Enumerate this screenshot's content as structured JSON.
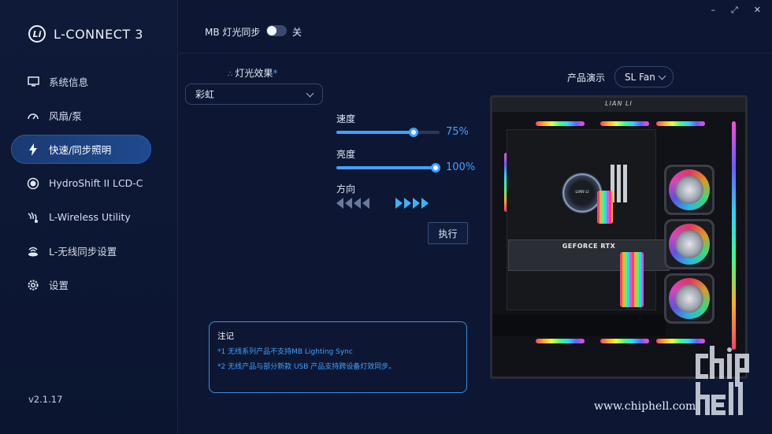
{
  "app": {
    "logo_glyph": "Li",
    "title": "L-CONNECT 3",
    "version": "v2.1.17"
  },
  "sidebar": {
    "items": [
      {
        "label": "系统信息",
        "icon": "monitor-icon"
      },
      {
        "label": "风扇/泵",
        "icon": "gauge-icon"
      },
      {
        "label": "快速/同步照明",
        "icon": "lightning-icon",
        "active": true
      },
      {
        "label": "HydroShift II LCD-C",
        "icon": "circle-icon"
      },
      {
        "label": "L-Wireless Utility",
        "icon": "wireless-fan-icon"
      },
      {
        "label": "L-无线同步设置",
        "icon": "wireless-sync-icon"
      },
      {
        "label": "设置",
        "icon": "gear-icon"
      }
    ]
  },
  "header": {
    "sync_label": "MB 灯光同步",
    "sync_state": "关",
    "sync_on": false
  },
  "window": {
    "minimize": "–",
    "maximize": "⤢",
    "close": "✕"
  },
  "lighting": {
    "effect_label": "灯光效果",
    "effect_required_mark": "*",
    "effect_value": "彩虹",
    "speed_label": "速度",
    "speed_value": "75%",
    "speed_level": 0.75,
    "brightness_label": "亮度",
    "brightness_value": "100%",
    "brightness_level": 1.0,
    "direction_label": "方向",
    "execute_label": "执行"
  },
  "notes": {
    "title": "注记",
    "lines": [
      "*1 无线系列产品不支持MB Lighting Sync",
      "*2 无线产品与部分新款 USB 产品支持跨设备灯效同步。"
    ]
  },
  "preview": {
    "product_label": "产品演示",
    "product_value": "SL Fan",
    "case_brand": "LIAN LI",
    "cooler_brand": "LIAN LI",
    "gpu_label": "GEFORCE RTX"
  },
  "watermark": {
    "url": "www.chiphell.com",
    "logo_text": "chip hell"
  },
  "colors": {
    "accent": "#3fa3ff",
    "background": "#0d1734",
    "sidebar": "#0e1a38",
    "active_nav": "#1f4a8e"
  }
}
